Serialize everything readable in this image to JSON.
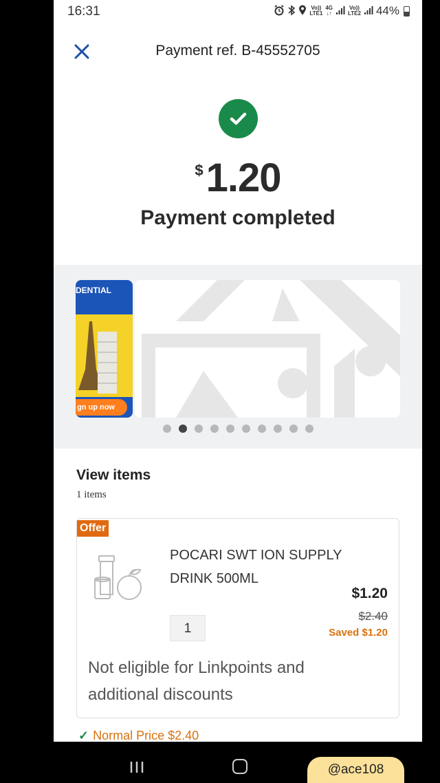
{
  "status_bar": {
    "time": "16:31",
    "network1_top": "Vo))",
    "network1_bottom": "LTE1",
    "network_type": "4G",
    "network2_top": "Vo))",
    "network2_bottom": "LTE2",
    "battery": "44%"
  },
  "header": {
    "title": "Payment ref. B-45552705"
  },
  "payment": {
    "currency": "$",
    "amount": "1.20",
    "status": "Payment completed",
    "accent_color": "#1a8a4a"
  },
  "banner": {
    "promo_text": "DENTIAL",
    "promo_cta": "gn up now",
    "dots_count": 10,
    "active_dot_index": 1
  },
  "items": {
    "title": "View items",
    "count_label": "1 items",
    "list": [
      {
        "badge": "Offer",
        "name": "POCARI SWT ION SUPPLY DRINK 500ML",
        "price": "$1.20",
        "original_price": "$2.40",
        "saved": "Saved $1.20",
        "quantity": "1",
        "note": "Not eligible for Linkpoints and additional discounts"
      }
    ],
    "normal_price": "Normal Price $2.40"
  },
  "watermark": "@ace108"
}
